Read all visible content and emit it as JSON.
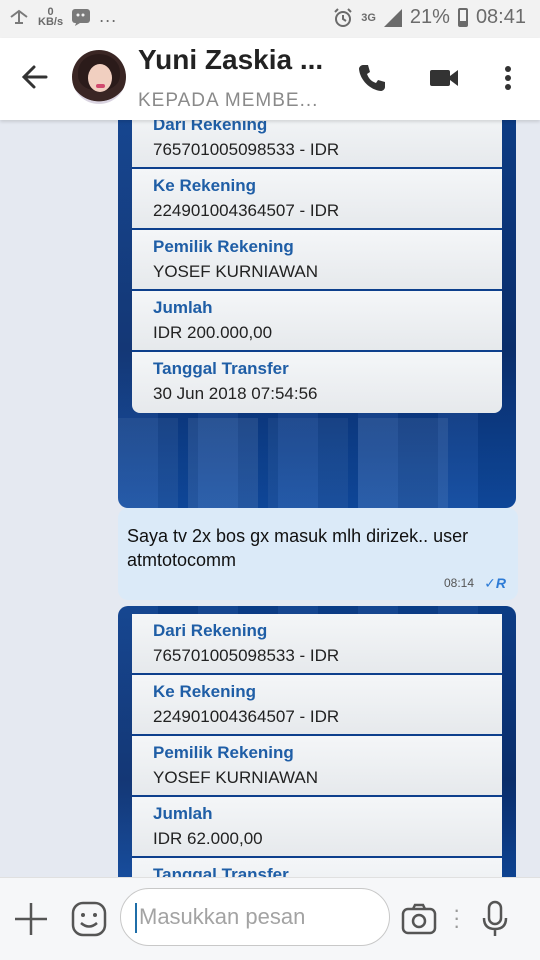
{
  "status_bar": {
    "speed_value": "0",
    "speed_unit": "KB/s",
    "more": "...",
    "network": "3G",
    "battery": "21%",
    "time": "08:41"
  },
  "header": {
    "contact_name": "Yuni Zaskia ...",
    "subtitle": "KEPADA MEMBE..."
  },
  "messages": [
    {
      "type": "image",
      "rows": [
        {
          "label": "Dari Rekening",
          "value": "765701005098533 - IDR"
        },
        {
          "label": "Ke Rekening",
          "value": "224901004364507 - IDR"
        },
        {
          "label": "Pemilik Rekening",
          "value": "YOSEF KURNIAWAN"
        },
        {
          "label": "Jumlah",
          "value": "IDR 200.000,00"
        },
        {
          "label": "Tanggal Transfer",
          "value": "30 Jun 2018 07:54:56"
        }
      ]
    },
    {
      "type": "text",
      "text": "Saya tv 2x bos gx masuk mlh dirizek.. user atmtotocomm",
      "time": "08:14",
      "read": "✓R"
    },
    {
      "type": "image",
      "rows": [
        {
          "label": "Dari Rekening",
          "value": "765701005098533 - IDR"
        },
        {
          "label": "Ke Rekening",
          "value": "224901004364507 - IDR"
        },
        {
          "label": "Pemilik Rekening",
          "value": "YOSEF KURNIAWAN"
        },
        {
          "label": "Jumlah",
          "value": "IDR 62.000,00"
        },
        {
          "label": "Tanggal Transfer",
          "value": ""
        }
      ]
    }
  ],
  "input": {
    "placeholder": "Masukkan pesan"
  },
  "icons": {
    "back": "arrow-left-icon",
    "call": "phone-icon",
    "video": "video-camera-icon",
    "menu": "more-vert-icon",
    "add": "plus-icon",
    "emoji": "emoji-icon",
    "camera": "camera-icon",
    "mic": "microphone-icon"
  },
  "colors": {
    "bank_label": "#1f5ea6",
    "bank_bg": "#0d3f8c",
    "bubble": "#dbeaf8",
    "read_tick": "#2d7bd6"
  }
}
